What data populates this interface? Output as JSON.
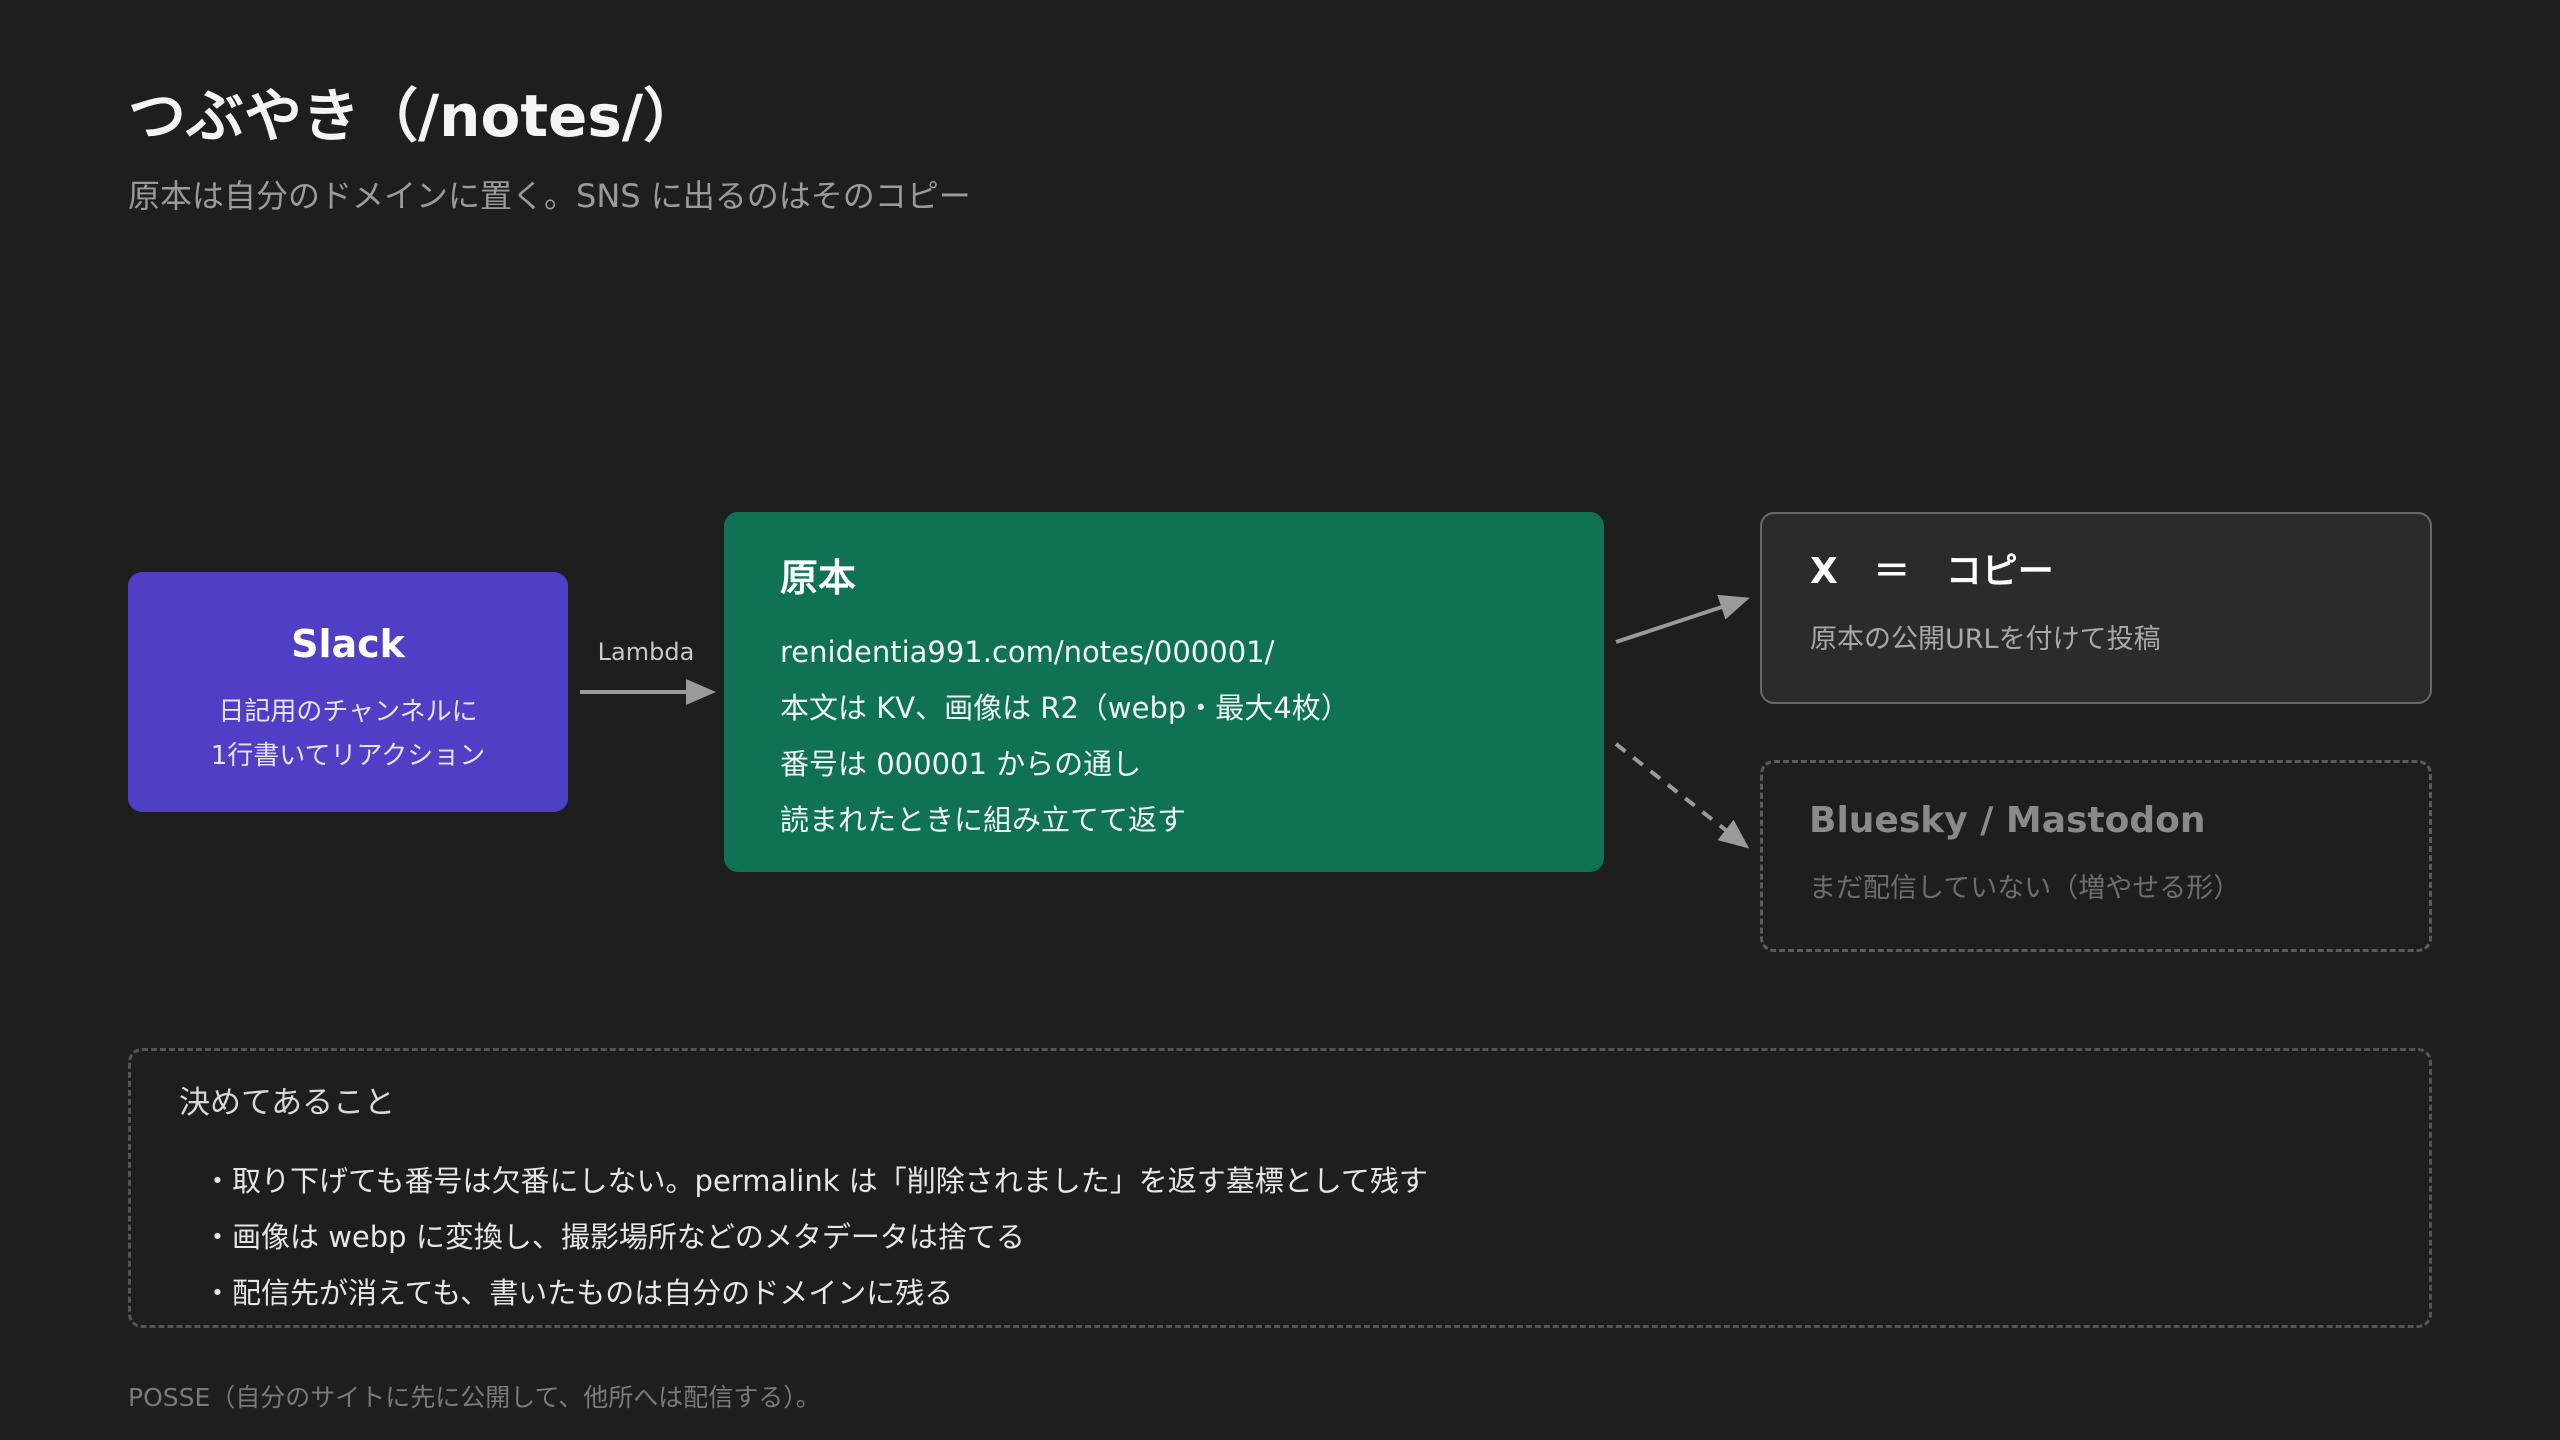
{
  "header": {
    "title": "つぶやき（/notes/）",
    "subtitle": "原本は自分のドメインに置く。SNS に出るのはそのコピー"
  },
  "nodes": {
    "slack": {
      "name": "Slack",
      "desc_line1": "日記用のチャンネルに",
      "desc_line2": "1行書いてリアクション"
    },
    "lambda_label": "Lambda",
    "origin": {
      "heading": "原本",
      "lines": [
        "renidentia991.com/notes/000001/",
        "本文は KV、画像は R2（webp・最大4枚）",
        "番号は 000001 からの通し",
        "読まれたときに組み立てて返す"
      ]
    },
    "x": {
      "head": "X　＝　コピー",
      "desc": "原本の公開URLを付けて投稿"
    },
    "bluesky": {
      "head": "Bluesky / Mastodon",
      "desc": "まだ配信していない（増やせる形）"
    }
  },
  "rules": {
    "heading": "決めてあること",
    "items": [
      "・取り下げても番号は欠番にしない。permalink は「削除されました」を返す墓標として残す",
      "・画像は webp に変換し、撮影場所などのメタデータは捨てる",
      "・配信先が消えても、書いたものは自分のドメインに残る"
    ]
  },
  "footnote": "POSSE（自分のサイトに先に公開して、他所へは配信する）。",
  "colors": {
    "background": "#1e1e1e",
    "slack": "#4f3fc5",
    "origin": "#0f7254",
    "x_box": "#2b2b2b",
    "arrow": "#9a9a9a"
  }
}
